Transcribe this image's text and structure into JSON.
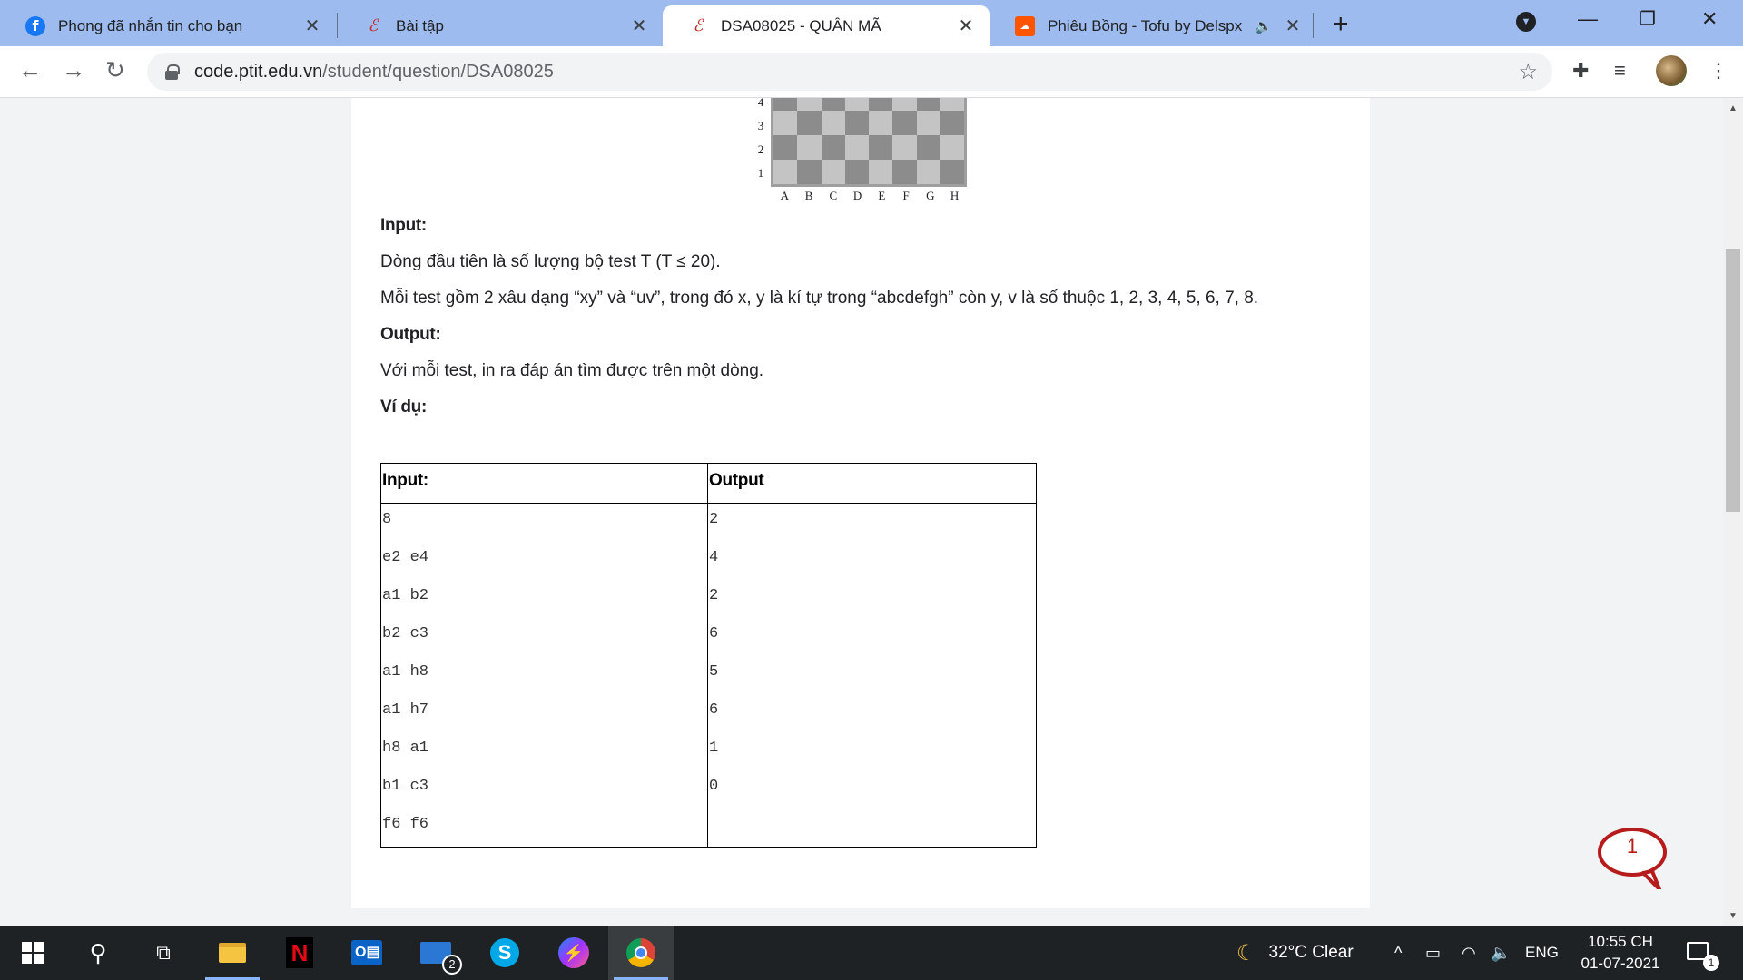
{
  "tabs": [
    {
      "title": "Phong đã nhắn tin cho bạn",
      "favicon": "facebook-icon"
    },
    {
      "title": "Bài tập",
      "favicon": "ptit-code-icon"
    },
    {
      "title": "DSA08025 - QUÂN MÃ",
      "favicon": "ptit-code-icon",
      "active": true
    },
    {
      "title": "Phiêu Bồng - Tofu by Delspx",
      "favicon": "soundcloud-icon",
      "audio": true
    }
  ],
  "address_bar": {
    "host": "code.ptit.edu.vn",
    "path": "/student/question/DSA08025"
  },
  "board": {
    "ranks": [
      "4",
      "3",
      "2",
      "1"
    ],
    "files": [
      "A",
      "B",
      "C",
      "D",
      "E",
      "F",
      "G",
      "H"
    ]
  },
  "problem": {
    "input_heading": "Input:",
    "input_line1": "Dòng đầu tiên là số lượng bộ test T (T ≤ 20).",
    "input_line2": "Mỗi test gồm 2 xâu dạng “xy” và “uv”, trong đó x, y là kí tự trong “abcdefgh” còn y, v là số thuộc 1, 2, 3, 4, 5, 6, 7, 8.",
    "output_heading": "Output:",
    "output_line1": "Với mỗi test, in ra đáp án tìm được trên một dòng.",
    "example_heading": "Ví dụ:"
  },
  "example_table": {
    "headers": [
      "Input:",
      "Output"
    ],
    "input_rows": [
      "8",
      "e2 e4",
      "a1 b2",
      "b2 c3",
      "a1 h8",
      "a1 h7",
      "h8 a1",
      "b1 c3",
      "f6 f6"
    ],
    "output_rows": [
      "2",
      "4",
      "2",
      "6",
      "5",
      "6",
      "1",
      "0"
    ]
  },
  "chat_badge": "1",
  "taskbar": {
    "mail_badge": "2",
    "weather": "32°C  Clear",
    "language": "ENG",
    "time": "10:55 CH",
    "date": "01-07-2021",
    "notification_count": "1"
  }
}
